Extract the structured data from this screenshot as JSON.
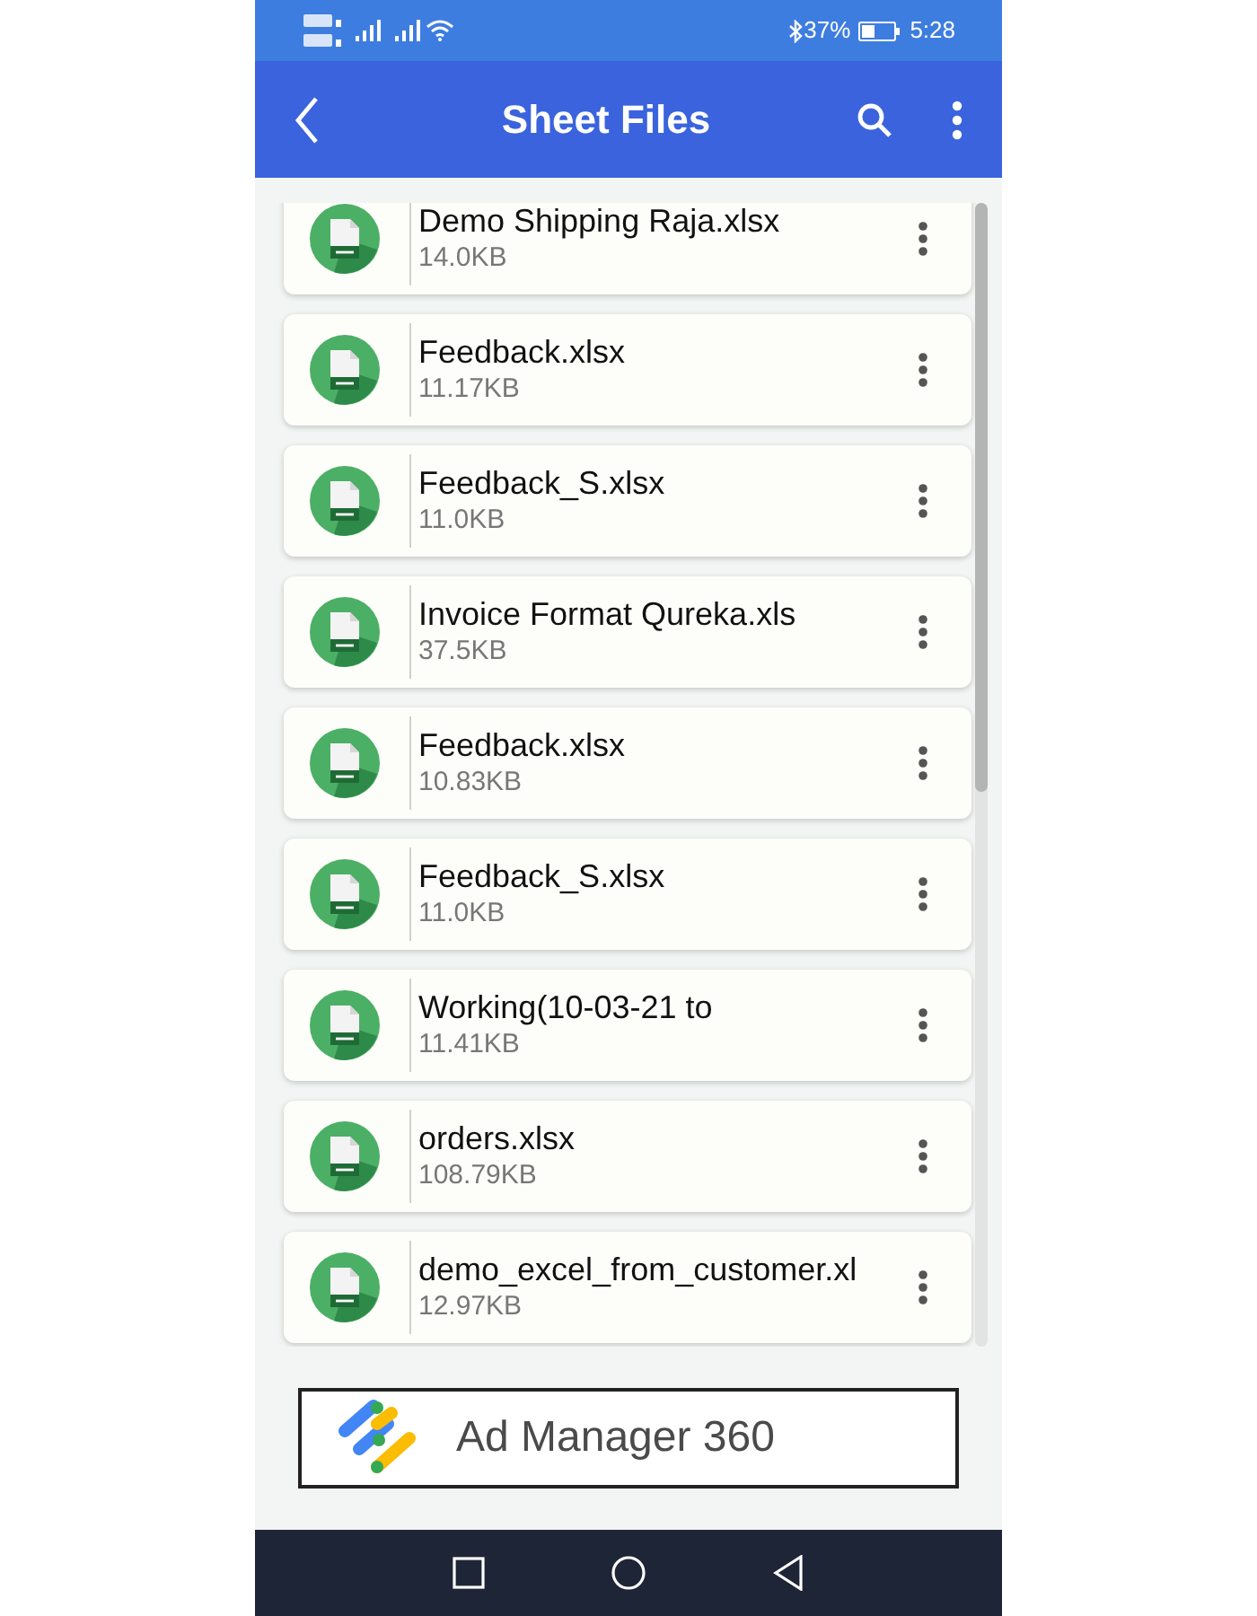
{
  "status_bar": {
    "battery_percent": "37%",
    "time": "5:28"
  },
  "app_bar": {
    "title": "Sheet Files"
  },
  "files": [
    {
      "name": "Demo Shipping Raja.xlsx",
      "size": "14.0KB"
    },
    {
      "name": "Feedback.xlsx",
      "size": "11.17KB"
    },
    {
      "name": "Feedback_S.xlsx",
      "size": "11.0KB"
    },
    {
      "name": "Invoice Format Qureka.xls",
      "size": "37.5KB"
    },
    {
      "name": "Feedback.xlsx",
      "size": "10.83KB"
    },
    {
      "name": "Feedback_S.xlsx",
      "size": "11.0KB"
    },
    {
      "name": "Working(10-03-21 to",
      "size": "11.41KB"
    },
    {
      "name": "orders.xlsx",
      "size": "108.79KB"
    },
    {
      "name": "demo_excel_from_customer.xl",
      "size": "12.97KB"
    }
  ],
  "ad_banner": {
    "text": "Ad Manager 360"
  }
}
